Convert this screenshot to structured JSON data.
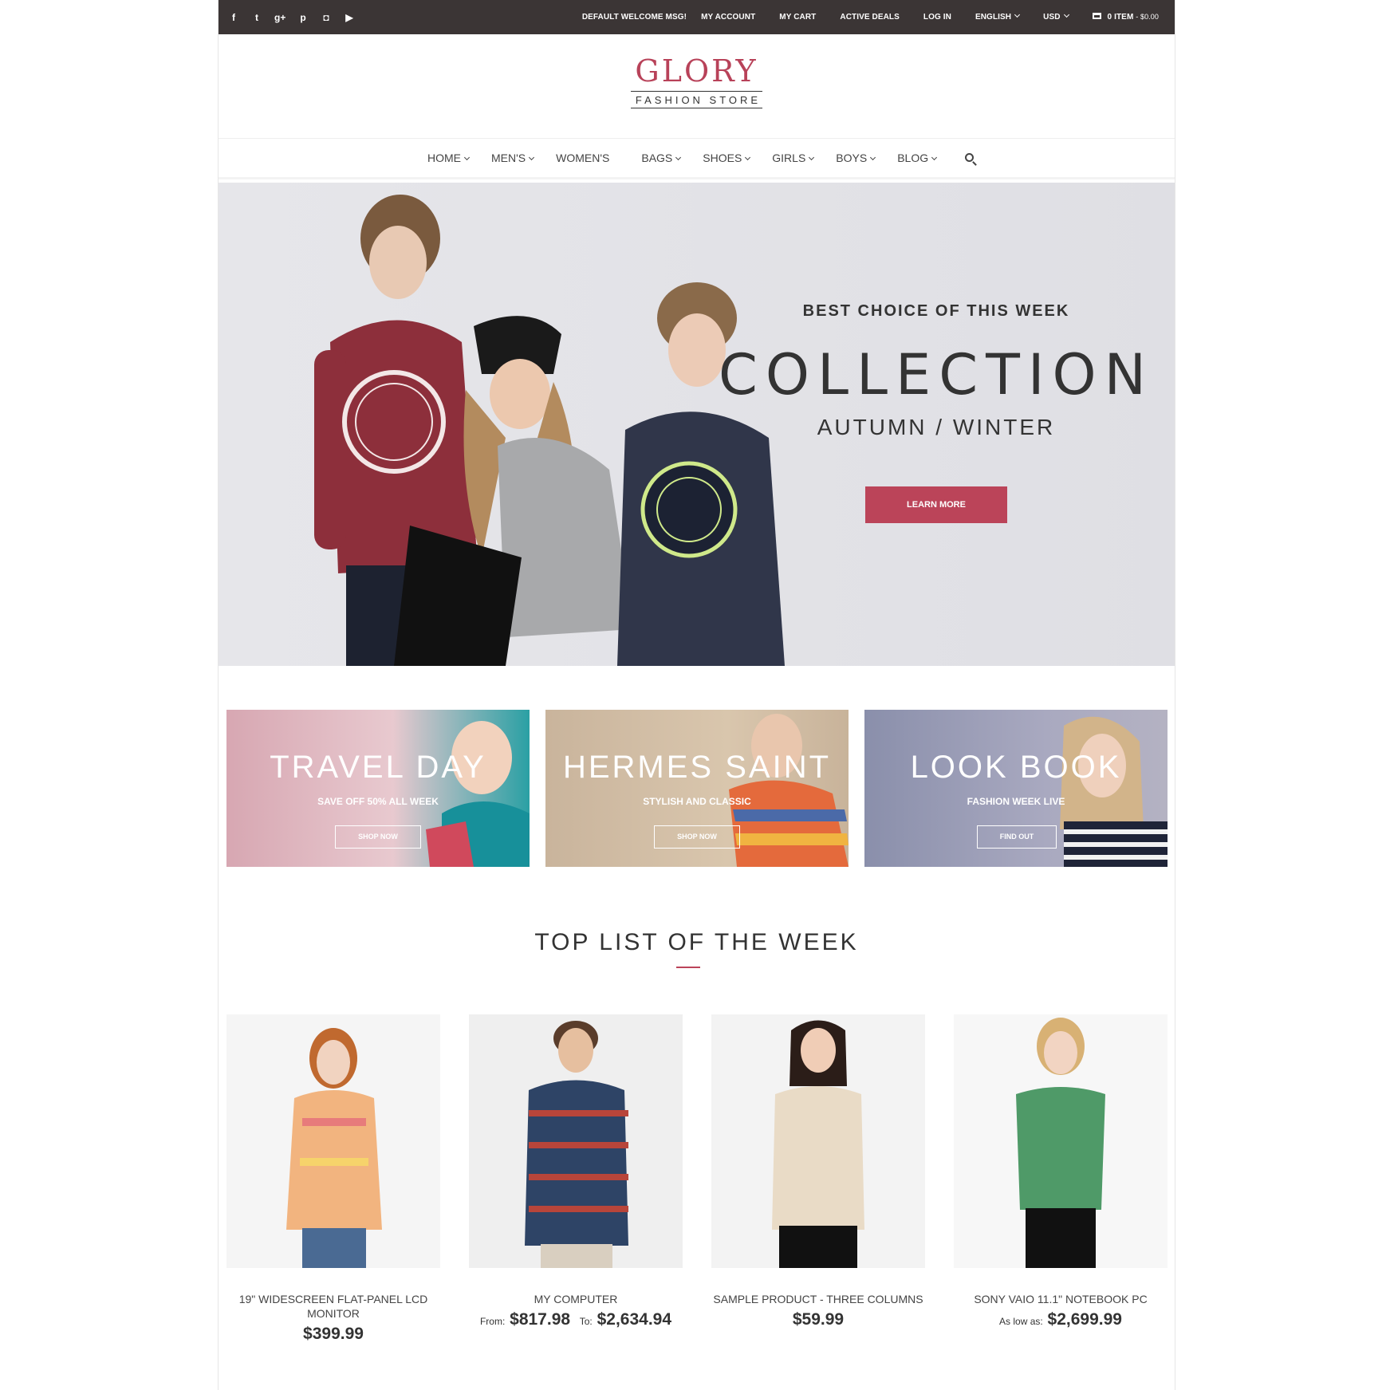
{
  "topbar": {
    "social_icons": [
      "facebook-icon",
      "twitter-icon",
      "google-plus-icon",
      "pinterest-icon",
      "instagram-icon",
      "youtube-icon"
    ],
    "links": {
      "welcome": "DEFAULT WELCOME MSG!",
      "account": "MY ACCOUNT",
      "cart": "MY CART",
      "deals": "ACTIVE DEALS",
      "login": "LOG IN",
      "language": "ENGLISH",
      "currency": "USD",
      "cart_items": "0 ITEM",
      "cart_total": "- $0.00"
    }
  },
  "logo": {
    "title": "GLORY",
    "subtitle": "FASHION STORE"
  },
  "nav": {
    "items": [
      "HOME",
      "MEN'S",
      "WOMEN'S",
      "BAGS",
      "SHOES",
      "GIRLS",
      "BOYS",
      "BLOG"
    ]
  },
  "hero": {
    "kicker": "BEST CHOICE OF THIS WEEK",
    "title": "COLLECTION",
    "subtitle": "AUTUMN / WINTER",
    "button": "LEARN MORE"
  },
  "banners": [
    {
      "title": "TRAVEL DAY",
      "subtitle": "SAVE OFF 50% ALL WEEK",
      "button": "SHOP NOW"
    },
    {
      "title": "HERMES SAINT",
      "subtitle": "STYLISH AND CLASSIC",
      "button": "SHOP NOW"
    },
    {
      "title": "LOOK BOOK",
      "subtitle": "FASHION WEEK LIVE",
      "button": "FIND OUT"
    }
  ],
  "top_list": {
    "title": "TOP LIST OF THE WEEK",
    "products": [
      {
        "name": "19\" WIDESCREEN FLAT-PANEL LCD MONITOR",
        "price": "$399.99"
      },
      {
        "name": "MY COMPUTER",
        "from_label": "From:",
        "from_price": "$817.98",
        "to_label": "To:",
        "to_price": "$2,634.94"
      },
      {
        "name": "SAMPLE PRODUCT - THREE COLUMNS",
        "price": "$59.99"
      },
      {
        "name": "SONY VAIO 11.1\" NOTEBOOK PC",
        "low_label": "As low as:",
        "price": "$2,699.99"
      }
    ]
  },
  "colors": {
    "accent": "#bb4459",
    "topbar_bg": "#3b3535"
  }
}
